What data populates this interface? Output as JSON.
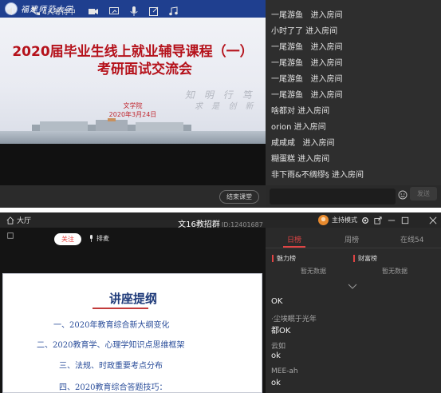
{
  "top_window": {
    "slide": {
      "university_name": "福建师范大学",
      "title_line1": "2020届毕业生线上就业辅导课程（一）",
      "title_line2": "考研面试交流会",
      "calligraphy": "知 明 行 笃",
      "calligraphy2": "求 是 创 新",
      "department": "文学院",
      "date": "2020年3月24日"
    },
    "controls": {
      "waiting_text": "4人等待中",
      "end_button": "结束课堂"
    },
    "chat": {
      "messages": [
        "一尾游鱼   进入房间",
        "小时了了 进入房间",
        "一尾游鱼   进入房间",
        "一尾游鱼   进入房间",
        "一尾游鱼   进入房间",
        "一尾游鱼   进入房间",
        "啥都对 进入房间",
        "orion 进入房间",
        "咸咸咸   进入房间",
        "糊蛋糕 进入房间",
        "非下雨&不绸缪§ 进入房间"
      ],
      "send_button": "发送"
    }
  },
  "bottom_window": {
    "titlebar": {
      "back_label": "大厅",
      "room_name": "文16教招群",
      "room_id": "ID:12401687",
      "mode_label": "主持模式"
    },
    "live": {
      "follow_button": "关注",
      "mic_label": "排麦"
    },
    "document": {
      "title": "讲座提纲",
      "items": [
        "一、2020年教育综合新大纲变化",
        "二、2020教育学、心理学知识点思维框架",
        "三、法规、时政重要考点分布",
        "四、2020教育综合答题技巧："
      ]
    },
    "ranking": {
      "tabs": [
        "日榜",
        "周榜",
        "在线54"
      ],
      "active_tab": 0,
      "charm_title": "魅力榜",
      "wealth_title": "财富榜",
      "empty_text": "暂无数据"
    },
    "chat": {
      "messages": [
        {
          "user": "",
          "text": "OK"
        },
        {
          "user": "·尘埃眠于光年",
          "text": "都OK"
        },
        {
          "user": "云如",
          "text": "ok"
        },
        {
          "user": "MEE-ah",
          "text": "ok"
        }
      ]
    },
    "accent_color": "#e04444"
  }
}
